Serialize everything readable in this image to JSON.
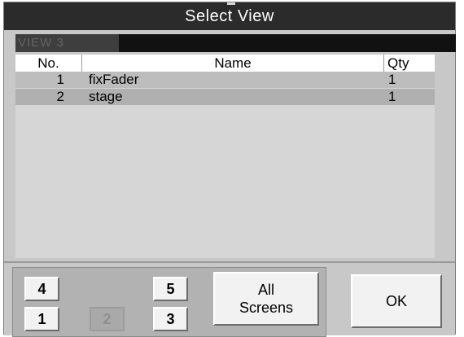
{
  "window": {
    "title": "Select View"
  },
  "view_field": {
    "label": "VIEW 3"
  },
  "table": {
    "headers": {
      "no": "No.",
      "name": "Name",
      "qty": "Qty"
    },
    "rows": [
      {
        "no": "1",
        "name": "fixFader",
        "qty": "1"
      },
      {
        "no": "2",
        "name": "stage",
        "qty": "1"
      }
    ]
  },
  "screens": {
    "buttons": [
      {
        "label": "4",
        "enabled": true
      },
      {
        "label": "5",
        "enabled": true
      },
      {
        "label": "1",
        "enabled": true
      },
      {
        "label": "2",
        "enabled": false
      },
      {
        "label": "3",
        "enabled": true
      }
    ],
    "all_screens": {
      "line1": "All",
      "line2": "Screens"
    }
  },
  "ok_button": {
    "label": "OK"
  }
}
